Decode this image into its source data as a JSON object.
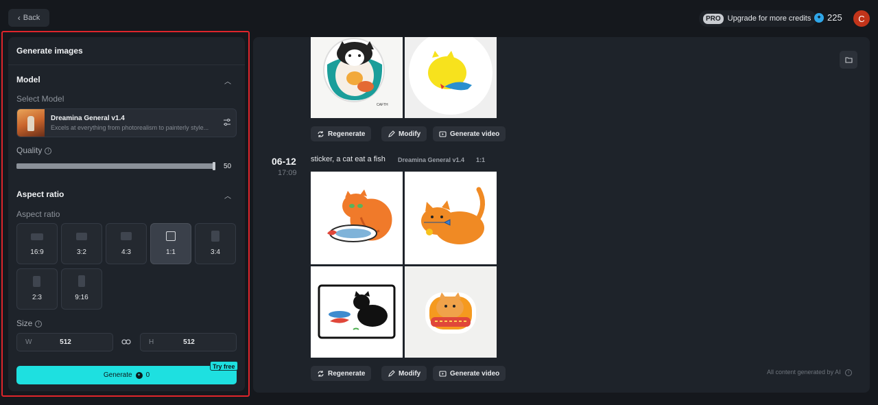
{
  "topbar": {
    "back_label": "Back",
    "pro_badge": "PRO",
    "upgrade_label": "Upgrade for more credits",
    "credits": "225",
    "avatar_letter": "C"
  },
  "panel": {
    "title": "Generate images",
    "model_section": "Model",
    "select_model_label": "Select Model",
    "model_name": "Dreamina General v1.4",
    "model_desc": "Excels at everything from photorealism to painterly style...",
    "quality_label": "Quality",
    "quality_value": "50",
    "quality_fraction": 1.0,
    "aspect_section": "Aspect ratio",
    "aspect_label": "Aspect ratio",
    "aspect_options": [
      "16:9",
      "3:2",
      "4:3",
      "1:1",
      "3:4",
      "2:3",
      "9:16"
    ],
    "aspect_selected": "1:1",
    "size_label": "Size",
    "width_prefix": "W",
    "width_value": "512",
    "height_prefix": "H",
    "height_value": "512",
    "generate_label": "Generate",
    "generate_cost": "0",
    "try_free": "Try free"
  },
  "main": {
    "actions": {
      "regenerate": "Regenerate",
      "modify": "Modify",
      "generate_video": "Generate video"
    },
    "entry": {
      "date": "06-12",
      "time": "17:09",
      "prompt": "sticker, a cat eat a fish",
      "model_tag": "Dreamina General v1.4",
      "ratio_tag": "1:1"
    },
    "footnote": "All content generated by AI",
    "colors": {
      "accent": "#1ee0e0",
      "highlight": "#e0252b"
    }
  }
}
